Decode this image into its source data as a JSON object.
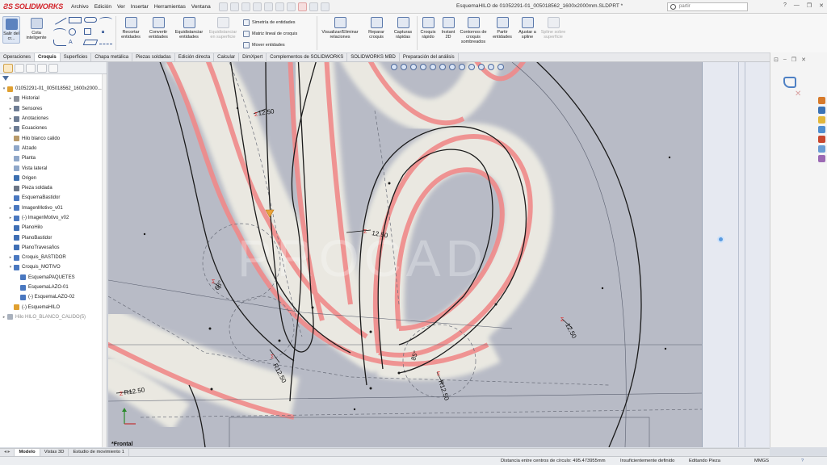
{
  "app": {
    "brand": "SOLIDWORKS",
    "title": "EsquemaHILO de 01052291-01_005018562_1600x2000mm.SLDPRT *",
    "menus": [
      "Archivo",
      "Edición",
      "Ver",
      "Insertar",
      "Herramientas",
      "Ventana"
    ],
    "search_placeholder": "partir"
  },
  "ribbon": {
    "exit_sketch": "Salir del cr...",
    "smart_dim": "Cota inteligente",
    "trim": "Recortar entidades",
    "convert": "Convertir entidades",
    "offset": "Equidistanciar entidades",
    "offset_surface": "Equidistanciar en superficie",
    "mirror": "Simetría de entidades",
    "linear_pattern": "Matriz lineal de croquis",
    "move": "Mover entidades",
    "relations": "Visualizar/Eliminar relaciones",
    "repair": "Reparar croquis",
    "quick_snaps": "Capturas rápidas",
    "rapid_sketch": "Croquis rápido",
    "instant2d": "Instant 2D",
    "shaded": "Contornos de croquis sombreados",
    "split": "Partir entidades",
    "fit_spline": "Ajustar a spline",
    "spline_surface": "Spline sobre superficie"
  },
  "tabs": [
    {
      "label": "Operaciones",
      "active": false
    },
    {
      "label": "Croquis",
      "active": true
    },
    {
      "label": "Superficies",
      "active": false
    },
    {
      "label": "Chapa metálica",
      "active": false
    },
    {
      "label": "Piezas soldadas",
      "active": false
    },
    {
      "label": "Edición directa",
      "active": false
    },
    {
      "label": "Calcular",
      "active": false
    },
    {
      "label": "DimXpert",
      "active": false
    },
    {
      "label": "Complementos de SOLIDWORKS",
      "active": false
    },
    {
      "label": "SOLIDWORKS MBD",
      "active": false
    },
    {
      "label": "Preparación del análisis",
      "active": false
    }
  ],
  "tree": [
    {
      "label": "01052291-01_005018562_1600x2000...",
      "indent": 0,
      "icon": "part-warning-icon",
      "color": "#e0a030",
      "expander": "▾"
    },
    {
      "label": "Historial",
      "indent": 1,
      "icon": "history-icon",
      "color": "#8a8f99",
      "expander": "▸"
    },
    {
      "label": "Sensores",
      "indent": 1,
      "icon": "sensor-icon",
      "color": "#6d7c94",
      "expander": "▸"
    },
    {
      "label": "Anotaciones",
      "indent": 1,
      "icon": "annotations-icon",
      "color": "#6d7c94",
      "expander": "▸"
    },
    {
      "label": "Ecuaciones",
      "indent": 1,
      "icon": "equations-icon",
      "color": "#6d7c94",
      "expander": "▸"
    },
    {
      "label": "Hilo blanco calido",
      "indent": 1,
      "icon": "material-icon",
      "color": "#b89a6a",
      "expander": ""
    },
    {
      "label": "Alzado",
      "indent": 1,
      "icon": "plane-icon",
      "color": "#8fa7c9",
      "expander": ""
    },
    {
      "label": "Planta",
      "indent": 1,
      "icon": "plane-icon",
      "color": "#8fa7c9",
      "expander": ""
    },
    {
      "label": "Vista lateral",
      "indent": 1,
      "icon": "plane-icon",
      "color": "#8fa7c9",
      "expander": ""
    },
    {
      "label": "Origen",
      "indent": 1,
      "icon": "origin-icon",
      "color": "#3c6fb0",
      "expander": ""
    },
    {
      "label": "Pieza soldada",
      "indent": 1,
      "icon": "weldment-icon",
      "color": "#6b7585",
      "expander": ""
    },
    {
      "label": "EsquemaBastidor",
      "indent": 1,
      "icon": "sketch-icon",
      "color": "#4a78c0",
      "expander": ""
    },
    {
      "label": "ImagenMotivo_v01",
      "indent": 1,
      "icon": "sketch-icon",
      "color": "#4a78c0",
      "expander": "▸"
    },
    {
      "label": "(-) ImagenMotivo_v02",
      "indent": 1,
      "icon": "sketch-icon",
      "color": "#4a78c0",
      "expander": "▸"
    },
    {
      "label": "PlanoHilo",
      "indent": 1,
      "icon": "plane-icon",
      "color": "#3f6fb5",
      "expander": ""
    },
    {
      "label": "PlanoBastidor",
      "indent": 1,
      "icon": "plane-icon",
      "color": "#3f6fb5",
      "expander": ""
    },
    {
      "label": "PlanoTravesaños",
      "indent": 1,
      "icon": "plane-icon",
      "color": "#3f6fb5",
      "expander": ""
    },
    {
      "label": "Croquis_BASTIDOR",
      "indent": 1,
      "icon": "sketch-icon",
      "color": "#4a78c0",
      "expander": "▸"
    },
    {
      "label": "Croquis_MOTIVO",
      "indent": 1,
      "icon": "sketch-icon",
      "color": "#4a78c0",
      "expander": "▾"
    },
    {
      "label": "EsquemaPAQUETES",
      "indent": 2,
      "icon": "sketch-icon",
      "color": "#4a78c0",
      "expander": ""
    },
    {
      "label": "EsquemaLAZO-01",
      "indent": 2,
      "icon": "sketch-icon",
      "color": "#4a78c0",
      "expander": ""
    },
    {
      "label": "(-) EsquemaLAZO-02",
      "indent": 2,
      "icon": "sketch-icon",
      "color": "#4a78c0",
      "expander": ""
    },
    {
      "label": "(-) EsquemaHILO",
      "indent": 1,
      "icon": "sketch-warning-icon",
      "color": "#e0a030",
      "expander": ""
    },
    {
      "label": "Hilo HILO_BLANCO_CALIDO(5)",
      "indent": 0,
      "icon": "feature-icon",
      "color": "#a9b1bd",
      "expander": "▸",
      "dim": true
    }
  ],
  "dimensions": [
    "12.50",
    "12.50",
    "R12.50",
    "R12.50",
    "R12.50",
    "12.50",
    "R12.50",
    "85°",
    "68°"
  ],
  "view_label": "*Frontal",
  "bottom_tabs": [
    {
      "label": "Modelo",
      "active": true
    },
    {
      "label": "Vistas 3D",
      "active": false
    },
    {
      "label": "Estudio de movimiento 1",
      "active": false
    }
  ],
  "status": {
    "distance": "Distancia entre centros de círculo: 495.473955mm",
    "defined": "Insuficientemente definido",
    "editing": "Editando Pieza",
    "units": "MMGS"
  },
  "colors": {
    "brand": "#d3232a",
    "sketch_line": "#1a1a1a",
    "neon": "#f08a8a",
    "canvas": "#b9bcc6"
  }
}
